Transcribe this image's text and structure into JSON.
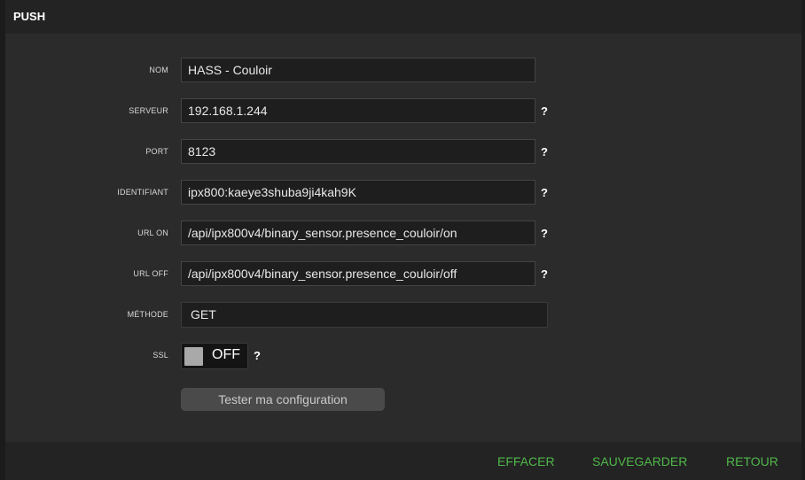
{
  "header": {
    "title": "PUSH"
  },
  "form": {
    "nom": {
      "label": "NOM",
      "value": "HASS - Couloir"
    },
    "serveur": {
      "label": "SERVEUR",
      "value": "192.168.1.244"
    },
    "port": {
      "label": "PORT",
      "value": "8123"
    },
    "identifiant": {
      "label": "IDENTIFIANT",
      "value": "ipx800:kaeye3shuba9ji4kah9K"
    },
    "url_on": {
      "label": "URL ON",
      "value": "/api/ipx800v4/binary_sensor.presence_couloir/on"
    },
    "url_off": {
      "label": "URL OFF",
      "value": "/api/ipx800v4/binary_sensor.presence_couloir/off"
    },
    "methode": {
      "label": "MÉTHODE",
      "value": "GET"
    },
    "ssl": {
      "label": "SSL",
      "state": "OFF"
    },
    "help_symbol": "?",
    "test_button": "Tester ma configuration"
  },
  "footer": {
    "effacer": "EFFACER",
    "sauvegarder": "SAUVEGARDER",
    "retour": "RETOUR"
  },
  "colors": {
    "accent_green": "#4fb84a",
    "panel_bg": "#2b2b2b",
    "field_bg": "#1e1e1e"
  }
}
